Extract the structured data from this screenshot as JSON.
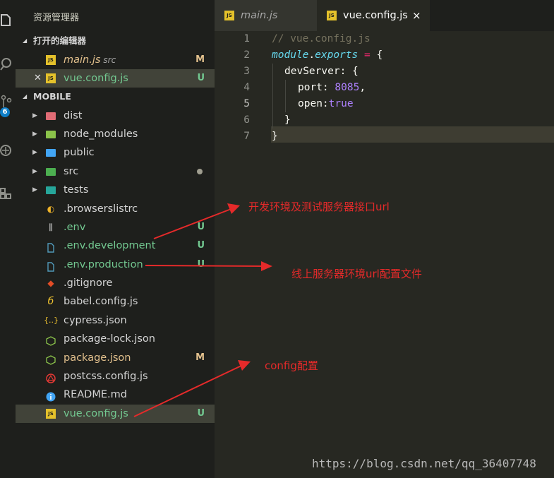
{
  "activity_bar": {
    "icons": [
      "explorer-icon",
      "search-icon",
      "source-control-icon",
      "debug-icon",
      "extensions-icon"
    ],
    "scm_badge": "6"
  },
  "sidebar": {
    "title": "资源管理器",
    "open_editors": {
      "label": "打开的编辑器",
      "items": [
        {
          "name": "main.js",
          "desc": "src",
          "badge": "M",
          "icon": "js-file-icon"
        },
        {
          "name": "vue.config.js",
          "desc": "",
          "badge": "U",
          "icon": "js-file-icon"
        }
      ]
    },
    "project": {
      "label": "MOBILE",
      "items": [
        {
          "name": "dist",
          "type": "folder",
          "icon": "folder-dist-icon",
          "color": "#e06c75"
        },
        {
          "name": "node_modules",
          "type": "folder",
          "icon": "folder-node-icon",
          "color": "#8bc34a"
        },
        {
          "name": "public",
          "type": "folder",
          "icon": "folder-public-icon",
          "color": "#42a5f5"
        },
        {
          "name": "src",
          "type": "folder",
          "icon": "folder-src-icon",
          "color": "#4caf50"
        },
        {
          "name": "tests",
          "type": "folder",
          "icon": "folder-tests-icon",
          "color": "#26a69a"
        },
        {
          "name": ".browserslistrc",
          "type": "file",
          "icon": "browserslist-icon"
        },
        {
          "name": ".env",
          "type": "file",
          "icon": "env-icon",
          "badge": "U"
        },
        {
          "name": ".env.development",
          "type": "file",
          "icon": "file-icon",
          "badge": "U"
        },
        {
          "name": ".env.production",
          "type": "file",
          "icon": "file-icon",
          "badge": "U"
        },
        {
          "name": ".gitignore",
          "type": "file",
          "icon": "git-icon"
        },
        {
          "name": "babel.config.js",
          "type": "file",
          "icon": "babel-icon"
        },
        {
          "name": "cypress.json",
          "type": "file",
          "icon": "json-icon"
        },
        {
          "name": "package-lock.json",
          "type": "file",
          "icon": "npm-icon"
        },
        {
          "name": "package.json",
          "type": "file",
          "icon": "npm-icon",
          "badge": "M"
        },
        {
          "name": "postcss.config.js",
          "type": "file",
          "icon": "postcss-icon"
        },
        {
          "name": "README.md",
          "type": "file",
          "icon": "info-icon"
        },
        {
          "name": "vue.config.js",
          "type": "file",
          "icon": "js-file-icon",
          "badge": "U"
        }
      ]
    }
  },
  "tabs": [
    {
      "label": "main.js",
      "icon": "js-file-icon"
    },
    {
      "label": "vue.config.js",
      "icon": "js-file-icon",
      "close": "×"
    }
  ],
  "code": {
    "line_numbers": [
      "1",
      "2",
      "3",
      "4",
      "5",
      "6",
      "7"
    ],
    "current_line": "5",
    "comment": "// vue.config.js",
    "module": "module",
    "dot": ".",
    "exports": "exports",
    "assign": " = ",
    "open_brace": "{",
    "devserver_key": "devServer: {",
    "port_key": "port: ",
    "port_value": "8085",
    "comma": ",",
    "open_key": "open:",
    "open_value": "true",
    "close_inner": "}",
    "close_outer": "}"
  },
  "annotations": {
    "dev_note": "开发环境及测试服务器接口url",
    "prod_note": "线上服务器环境url配置文件",
    "config_note": "config配置",
    "color": "#e52a2a"
  },
  "watermark": "https://blog.csdn.net/qq_36407748"
}
